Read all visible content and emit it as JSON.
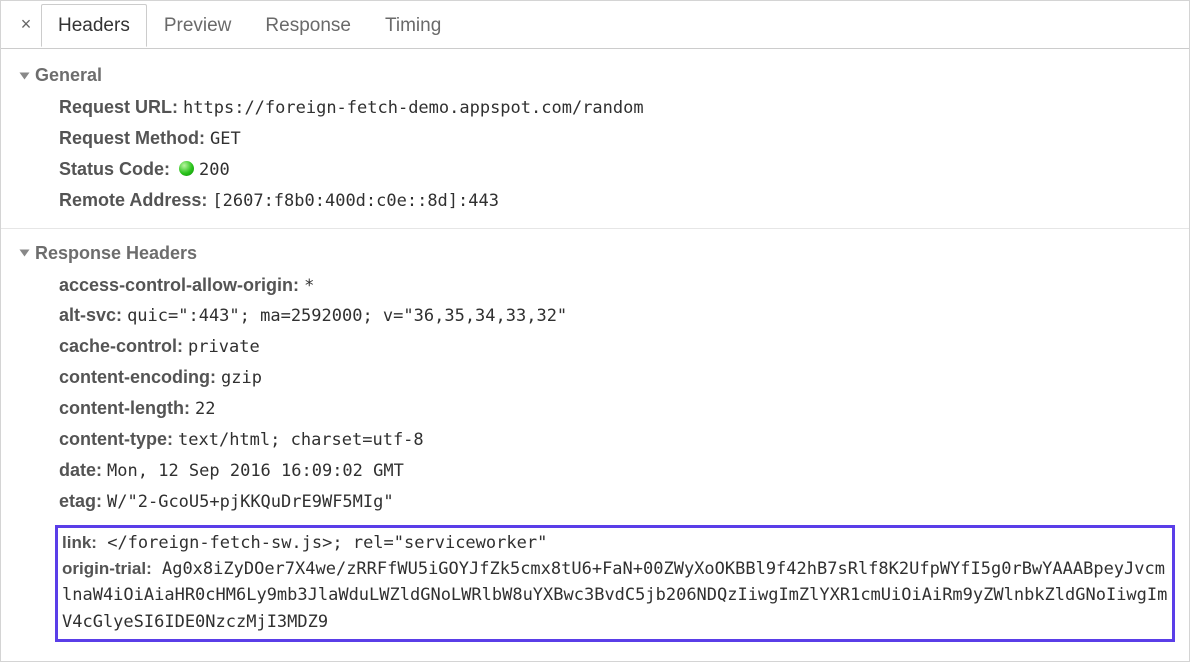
{
  "tabs": {
    "close": "×",
    "headers": "Headers",
    "preview": "Preview",
    "response": "Response",
    "timing": "Timing"
  },
  "sections": {
    "general": {
      "title": "General",
      "request_url_label": "Request URL",
      "request_url_value": "https://foreign-fetch-demo.appspot.com/random",
      "request_method_label": "Request Method",
      "request_method_value": "GET",
      "status_code_label": "Status Code",
      "status_code_value": "200",
      "remote_address_label": "Remote Address",
      "remote_address_value": "[2607:f8b0:400d:c0e::8d]:443"
    },
    "response_headers": {
      "title": "Response Headers",
      "items": [
        {
          "key": "access-control-allow-origin",
          "value": "*"
        },
        {
          "key": "alt-svc",
          "value": "quic=\":443\"; ma=2592000; v=\"36,35,34,33,32\""
        },
        {
          "key": "cache-control",
          "value": "private"
        },
        {
          "key": "content-encoding",
          "value": "gzip"
        },
        {
          "key": "content-length",
          "value": "22"
        },
        {
          "key": "content-type",
          "value": "text/html; charset=utf-8"
        },
        {
          "key": "date",
          "value": "Mon, 12 Sep 2016 16:09:02 GMT"
        },
        {
          "key": "etag",
          "value": "W/\"2-GcoU5+pjKKQuDrE9WF5MIg\""
        }
      ],
      "highlighted": [
        {
          "key": "link",
          "value": "</foreign-fetch-sw.js>; rel=\"serviceworker\""
        },
        {
          "key": "origin-trial",
          "value": "Ag0x8iZyDOer7X4we/zRRFfWU5iGOYJfZk5cmx8tU6+FaN+00ZWyXoOKBBl9f42hB7sRlf8K2UfpWYfI5g0rBwYAAABpeyJvcmlnaW4iOiAiaHR0cHM6Ly9mb3JlaWduLWZldGNoLWRlbW8uYXBwc3BvdC5jb206NDQzIiwgImZlYXR1cmUiOiAiRm9yZWlnbkZldGNoIiwgImV4cGlyeSI6IDE0NzczMjI3MDZ9"
        }
      ]
    }
  }
}
